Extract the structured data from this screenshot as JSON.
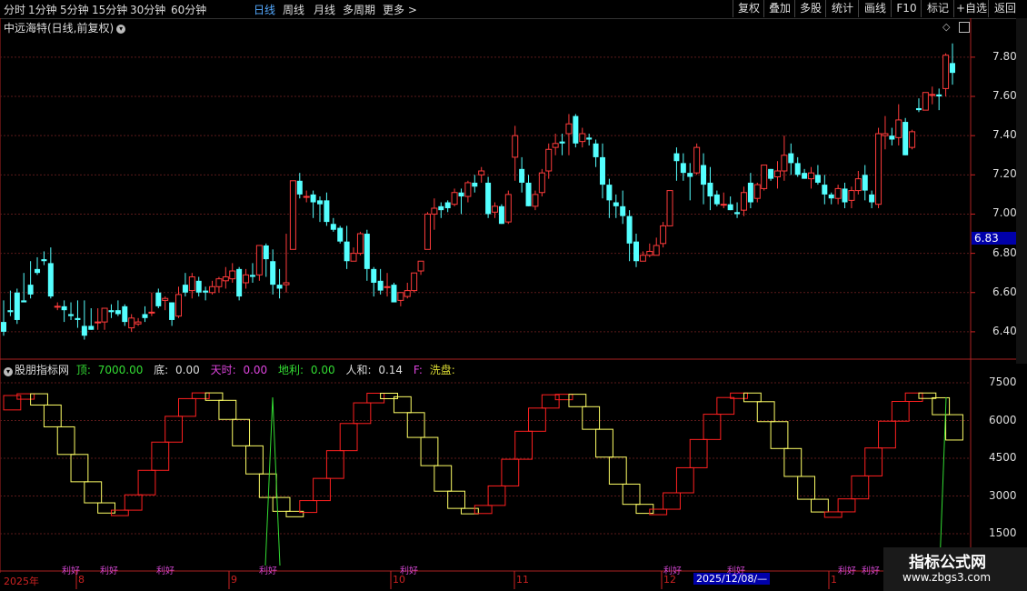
{
  "toolbar": {
    "periods": [
      "分时",
      "1分钟",
      "5分钟",
      "15分钟",
      "30分钟",
      "60分钟",
      "日线",
      "周线",
      "月线",
      "多周期",
      "更多 >"
    ],
    "active": "日线",
    "right": [
      "复权",
      "叠加",
      "多股",
      "统计",
      "画线",
      "F10",
      "标记",
      "+自选",
      "返回"
    ]
  },
  "chart_title": "中远海特(日线,前复权)",
  "price_axis": [
    "7.80",
    "7.60",
    "7.40",
    "7.20",
    "7.00",
    "6.80",
    "6.60",
    "6.40"
  ],
  "price_marker": "6.83",
  "indicator": {
    "name": "股朋指标网",
    "top_label": "顶:",
    "top_val": "7000.00",
    "bottom_label": "底:",
    "bottom_val": "0.00",
    "tian_label": "天时:",
    "tian_val": "0.00",
    "di_label": "地利:",
    "di_val": "0.00",
    "ren_label": "人和:",
    "ren_val": "0.14",
    "f_label": "F:",
    "f_val": "洗盘:"
  },
  "ind_axis": [
    "7500",
    "6000",
    "4500",
    "3000",
    "1500"
  ],
  "date_axis": {
    "year": "2025年",
    "months": [
      "8",
      "9",
      "10",
      "11",
      "12",
      "1"
    ],
    "cursor": "2025/12/08/—"
  },
  "signal_label": "利好",
  "watermark": {
    "title": "指标公式网",
    "url": "www.zbgs3.com"
  },
  "colors": {
    "up": "#ff3b3b",
    "down": "#54ffff",
    "grid": "#5a1a1a",
    "yellow": "#ffff66",
    "red": "#ff2020",
    "green": "#33dd33",
    "purple": "#cc44cc"
  },
  "chart_data": {
    "type": "candlestick",
    "ylim": [
      6.33,
      7.92
    ],
    "ohlc": [
      [
        6.45,
        6.56,
        6.4,
        6.38
      ],
      [
        6.51,
        6.61,
        6.5,
        6.48
      ],
      [
        6.6,
        6.62,
        6.46,
        6.44
      ],
      [
        6.56,
        6.7,
        6.55,
        6.55
      ],
      [
        6.64,
        6.76,
        6.59,
        6.57
      ],
      [
        6.72,
        6.78,
        6.7,
        6.69
      ],
      [
        6.77,
        6.81,
        6.76,
        6.74
      ],
      [
        6.75,
        6.83,
        6.58,
        6.57
      ],
      [
        6.53,
        6.55,
        6.53,
        6.51
      ],
      [
        6.53,
        6.56,
        6.51,
        6.45
      ],
      [
        6.49,
        6.55,
        6.48,
        6.46
      ],
      [
        6.47,
        6.56,
        6.46,
        6.42
      ],
      [
        6.43,
        6.56,
        6.38,
        6.36
      ],
      [
        6.43,
        6.52,
        6.41,
        6.41
      ],
      [
        6.45,
        6.52,
        6.45,
        6.41
      ],
      [
        6.45,
        6.52,
        6.52,
        6.41
      ],
      [
        6.51,
        6.54,
        6.5,
        6.47
      ],
      [
        6.51,
        6.56,
        6.49,
        6.48
      ],
      [
        6.53,
        6.54,
        6.45,
        6.43
      ],
      [
        6.42,
        6.49,
        6.47,
        6.4
      ],
      [
        6.44,
        6.47,
        6.45,
        6.43
      ],
      [
        6.49,
        6.53,
        6.47,
        6.45
      ],
      [
        6.5,
        6.6,
        6.5,
        6.48
      ],
      [
        6.6,
        6.62,
        6.53,
        6.52
      ],
      [
        6.56,
        6.58,
        6.57,
        6.51
      ],
      [
        6.55,
        6.54,
        6.46,
        6.43
      ],
      [
        6.48,
        6.63,
        6.59,
        6.47
      ],
      [
        6.64,
        6.7,
        6.6,
        6.58
      ],
      [
        6.61,
        6.7,
        6.68,
        6.57
      ],
      [
        6.66,
        6.68,
        6.6,
        6.58
      ],
      [
        6.61,
        6.63,
        6.6,
        6.56
      ],
      [
        6.6,
        6.66,
        6.63,
        6.59
      ],
      [
        6.63,
        6.68,
        6.67,
        6.6
      ],
      [
        6.66,
        6.73,
        6.68,
        6.62
      ],
      [
        6.67,
        6.75,
        6.71,
        6.65
      ],
      [
        6.72,
        6.73,
        6.58,
        6.56
      ],
      [
        6.65,
        6.72,
        6.69,
        6.62
      ],
      [
        6.69,
        6.75,
        6.68,
        6.65
      ],
      [
        6.69,
        6.84,
        6.84,
        6.66
      ],
      [
        6.84,
        6.85,
        6.77,
        6.68
      ],
      [
        6.76,
        6.82,
        6.64,
        6.59
      ],
      [
        6.64,
        6.72,
        6.62,
        6.57
      ],
      [
        6.64,
        6.9,
        6.65,
        6.6
      ],
      [
        6.82,
        7.17,
        7.17,
        6.82
      ],
      [
        7.17,
        7.21,
        7.1,
        7.08
      ],
      [
        7.09,
        7.12,
        7.09,
        7.06
      ],
      [
        7.1,
        7.12,
        7.06,
        6.98
      ],
      [
        7.07,
        7.09,
        7.05,
        6.96
      ],
      [
        7.07,
        7.11,
        6.96,
        6.94
      ],
      [
        6.95,
        6.98,
        6.92,
        6.91
      ],
      [
        6.93,
        6.94,
        6.86,
        6.85
      ],
      [
        6.86,
        6.94,
        6.76,
        6.72
      ],
      [
        6.76,
        6.83,
        6.8,
        6.76
      ],
      [
        6.8,
        6.91,
        6.9,
        6.79
      ],
      [
        6.9,
        6.92,
        6.72,
        6.66
      ],
      [
        6.72,
        6.73,
        6.65,
        6.58
      ],
      [
        6.66,
        6.72,
        6.61,
        6.59
      ],
      [
        6.63,
        6.7,
        6.63,
        6.58
      ],
      [
        6.64,
        6.65,
        6.55,
        6.55
      ],
      [
        6.56,
        6.6,
        6.6,
        6.53
      ],
      [
        6.58,
        6.65,
        6.61,
        6.57
      ],
      [
        6.61,
        6.7,
        6.7,
        6.6
      ],
      [
        6.71,
        6.76,
        6.76,
        6.69
      ],
      [
        6.82,
        7.01,
        7.0,
        6.82
      ],
      [
        7.0,
        7.08,
        7.03,
        6.92
      ],
      [
        7.04,
        7.06,
        7.02,
        6.98
      ],
      [
        7.06,
        7.07,
        7.03,
        7.01
      ],
      [
        7.05,
        7.13,
        7.11,
        7.04
      ],
      [
        7.11,
        7.13,
        7.09,
        7.0
      ],
      [
        7.09,
        7.17,
        7.16,
        7.06
      ],
      [
        7.16,
        7.2,
        7.14,
        7.11
      ],
      [
        7.2,
        7.24,
        7.22,
        7.16
      ],
      [
        7.16,
        7.19,
        7.0,
        6.98
      ],
      [
        7.01,
        7.06,
        7.04,
        6.98
      ],
      [
        7.04,
        7.05,
        6.95,
        6.95
      ],
      [
        6.96,
        7.12,
        7.1,
        6.95
      ],
      [
        7.29,
        7.45,
        7.4,
        7.17
      ],
      [
        7.23,
        7.29,
        7.16,
        7.11
      ],
      [
        7.16,
        7.2,
        7.04,
        7.04
      ],
      [
        7.04,
        7.12,
        7.1,
        7.02
      ],
      [
        7.11,
        7.23,
        7.21,
        7.09
      ],
      [
        7.22,
        7.36,
        7.33,
        7.18
      ],
      [
        7.34,
        7.41,
        7.36,
        7.3
      ],
      [
        7.37,
        7.41,
        7.36,
        7.3
      ],
      [
        7.41,
        7.51,
        7.46,
        7.3
      ],
      [
        7.5,
        7.51,
        7.36,
        7.34
      ],
      [
        7.37,
        7.44,
        7.41,
        7.34
      ],
      [
        7.39,
        7.41,
        7.38,
        7.35
      ],
      [
        7.36,
        7.38,
        7.29,
        7.24
      ],
      [
        7.29,
        7.36,
        7.15,
        7.08
      ],
      [
        7.15,
        7.18,
        7.07,
        6.98
      ],
      [
        7.06,
        7.1,
        7.04,
        6.98
      ],
      [
        7.04,
        7.12,
        6.99,
        6.95
      ],
      [
        6.99,
        7.02,
        6.85,
        6.76
      ],
      [
        6.86,
        6.9,
        6.76,
        6.73
      ],
      [
        6.76,
        6.81,
        6.79,
        6.76
      ],
      [
        6.79,
        6.85,
        6.81,
        6.78
      ],
      [
        6.79,
        6.88,
        6.84,
        6.79
      ],
      [
        6.85,
        6.96,
        6.94,
        6.83
      ],
      [
        6.94,
        7.1,
        7.12,
        6.97
      ],
      [
        7.31,
        7.34,
        7.27,
        7.17
      ],
      [
        7.26,
        7.31,
        7.21,
        7.17
      ],
      [
        7.21,
        7.26,
        7.19,
        7.07
      ],
      [
        7.21,
        7.36,
        7.34,
        7.2
      ],
      [
        7.25,
        7.31,
        7.15,
        7.05
      ],
      [
        7.16,
        7.24,
        7.09,
        7.02
      ],
      [
        7.1,
        7.12,
        7.05,
        7.04
      ],
      [
        7.05,
        7.11,
        7.05,
        7.03
      ],
      [
        7.05,
        7.09,
        7.02,
        7.03
      ],
      [
        7.01,
        7.06,
        7.0,
        6.98
      ],
      [
        7.02,
        7.14,
        7.11,
        6.99
      ],
      [
        7.16,
        7.21,
        7.06,
        7.03
      ],
      [
        7.08,
        7.16,
        7.15,
        7.06
      ],
      [
        7.13,
        7.25,
        7.25,
        7.12
      ],
      [
        7.23,
        7.23,
        7.18,
        7.17
      ],
      [
        7.19,
        7.27,
        7.22,
        7.13
      ],
      [
        7.22,
        7.4,
        7.3,
        7.17
      ],
      [
        7.31,
        7.36,
        7.26,
        7.2
      ],
      [
        7.26,
        7.29,
        7.2,
        7.19
      ],
      [
        7.21,
        7.23,
        7.18,
        7.18
      ],
      [
        7.18,
        7.24,
        7.21,
        7.13
      ],
      [
        7.2,
        7.25,
        7.16,
        7.15
      ],
      [
        7.15,
        7.2,
        7.1,
        7.05
      ],
      [
        7.1,
        7.11,
        7.08,
        7.05
      ],
      [
        7.08,
        7.15,
        7.13,
        7.05
      ],
      [
        7.13,
        7.16,
        7.06,
        7.03
      ],
      [
        7.07,
        7.14,
        7.12,
        7.03
      ],
      [
        7.12,
        7.22,
        7.18,
        7.1
      ],
      [
        7.2,
        7.25,
        7.12,
        7.07
      ],
      [
        7.1,
        7.12,
        7.06,
        7.03
      ],
      [
        7.05,
        7.44,
        7.41,
        7.03
      ],
      [
        7.4,
        7.5,
        7.41,
        7.33
      ],
      [
        7.4,
        7.44,
        7.38,
        7.35
      ],
      [
        7.39,
        7.56,
        7.48,
        7.35
      ],
      [
        7.47,
        7.49,
        7.3,
        7.3
      ],
      [
        7.34,
        7.43,
        7.42,
        7.33
      ],
      [
        7.54,
        7.59,
        7.53,
        7.52
      ],
      [
        7.53,
        7.6,
        7.62,
        7.54
      ],
      [
        7.61,
        7.65,
        7.61,
        7.56
      ],
      [
        7.61,
        7.64,
        7.6,
        7.53
      ],
      [
        7.64,
        7.82,
        7.81,
        7.6
      ],
      [
        7.77,
        7.87,
        7.72,
        7.66
      ]
    ]
  }
}
